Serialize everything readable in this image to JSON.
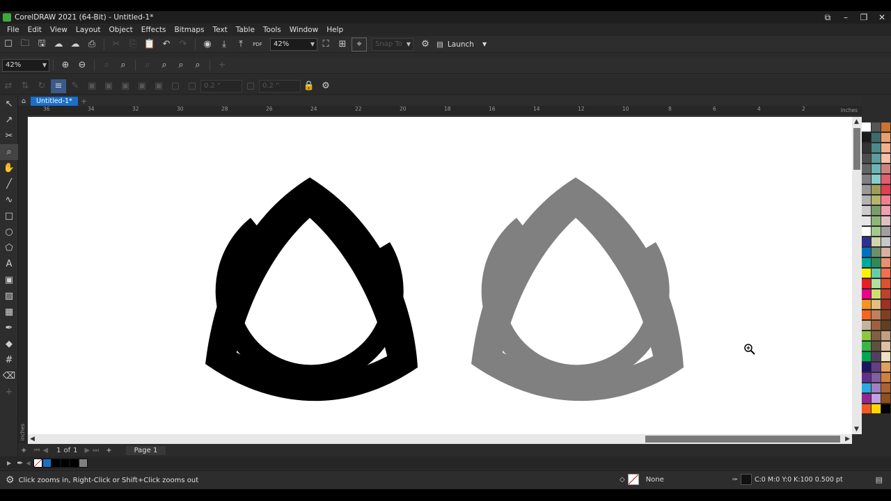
{
  "window": {
    "title": "CorelDRAW 2021 (64-Bit) - Untitled-1*",
    "controls": [
      "restore-icon",
      "minimize-icon",
      "maximize-icon",
      "close-icon"
    ]
  },
  "menu": [
    "File",
    "Edit",
    "View",
    "Layout",
    "Object",
    "Effects",
    "Bitmaps",
    "Text",
    "Table",
    "Tools",
    "Window",
    "Help"
  ],
  "standard_toolbar": {
    "zoom_value": "42%",
    "snap_to_label": "Snap To",
    "launch_label": "Launch"
  },
  "property_bar": {
    "zoom_value": "42%"
  },
  "object_bar": {
    "outline_width_1": "0.2 \"",
    "outline_width_2": "0.2 \""
  },
  "document": {
    "tab_label": "Untitled-1*",
    "ruler_unit": "inches",
    "ruler_ticks": [
      "36",
      "34",
      "32",
      "30",
      "28",
      "26",
      "24",
      "22",
      "20",
      "18",
      "16",
      "14",
      "12",
      "10",
      "8",
      "6",
      "4",
      "2"
    ],
    "vertical_ruler_unit": "inches"
  },
  "canvas": {
    "shapes": [
      {
        "name": "triquetra-black",
        "fill": "#000000"
      },
      {
        "name": "triquetra-gray",
        "fill": "#808080"
      }
    ]
  },
  "page_nav": {
    "position": "1",
    "of_label": "of",
    "total": "1",
    "page_tab": "Page 1"
  },
  "status": {
    "hint": "Click zooms in, Right-Click or Shift+Click zooms out",
    "fill_label": "None",
    "outline_info": "C:0 M:0 Y:0 K:100  0.500 pt"
  },
  "colors": {
    "accent": "#1a6fc9",
    "ui_bg": "#2d2d2d",
    "canvas_bg": "#ffffff",
    "gray_shape": "#808080"
  }
}
